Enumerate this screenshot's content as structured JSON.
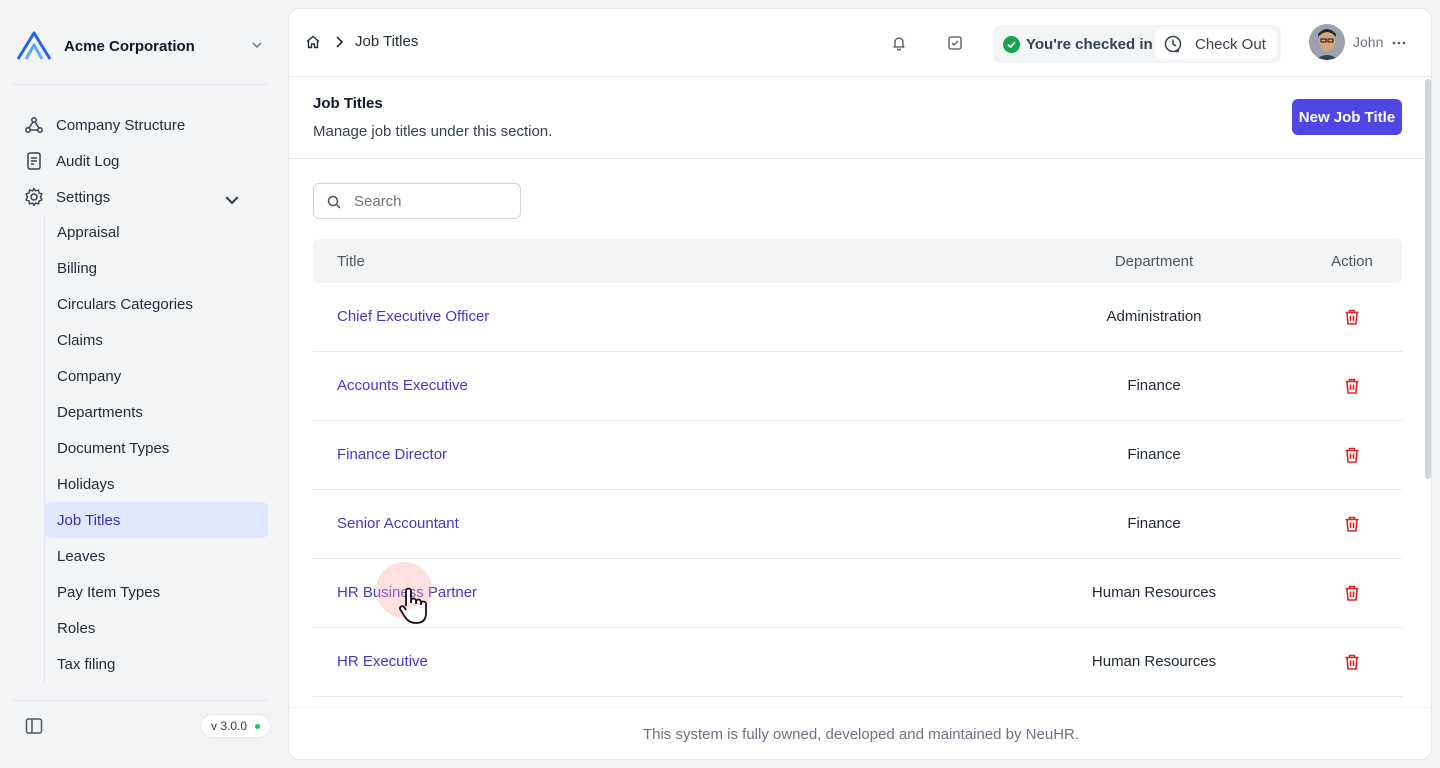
{
  "org": {
    "name": "Acme Corporation",
    "logo_icon": "acme-logo-icon"
  },
  "nav": {
    "company_structure": "Company Structure",
    "audit_log": "Audit Log",
    "settings": "Settings"
  },
  "settings_items": [
    {
      "label": "Appraisal"
    },
    {
      "label": "Billing"
    },
    {
      "label": "Circulars Categories"
    },
    {
      "label": "Claims"
    },
    {
      "label": "Company"
    },
    {
      "label": "Departments"
    },
    {
      "label": "Document Types"
    },
    {
      "label": "Holidays"
    },
    {
      "label": "Job Titles",
      "active": true
    },
    {
      "label": "Leaves"
    },
    {
      "label": "Pay Item Types"
    },
    {
      "label": "Roles"
    },
    {
      "label": "Tax filing"
    }
  ],
  "version": "v 3.0.0",
  "breadcrumb": {
    "current": "Job Titles"
  },
  "checkin": {
    "status": "You're checked in",
    "checkout_label": "Check Out"
  },
  "user": {
    "name": "John"
  },
  "page": {
    "title": "Job Titles",
    "subtitle": "Manage job titles under this section.",
    "new_button": "New Job Title"
  },
  "search": {
    "placeholder": "Search"
  },
  "table": {
    "headers": {
      "title": "Title",
      "department": "Department",
      "action": "Action"
    },
    "rows": [
      {
        "title": "Chief Executive Officer",
        "department": "Administration"
      },
      {
        "title": "Accounts Executive",
        "department": "Finance"
      },
      {
        "title": "Finance Director",
        "department": "Finance"
      },
      {
        "title": "Senior Accountant",
        "department": "Finance"
      },
      {
        "title": "HR Business Partner",
        "department": "Human Resources"
      },
      {
        "title": "HR Executive",
        "department": "Human Resources"
      }
    ]
  },
  "footer": "This system is fully owned, developed and maintained by NeuHR.",
  "colors": {
    "accent": "#4f46e5",
    "link": "#4338ca",
    "danger": "#dc2626",
    "success": "#16a34a"
  }
}
